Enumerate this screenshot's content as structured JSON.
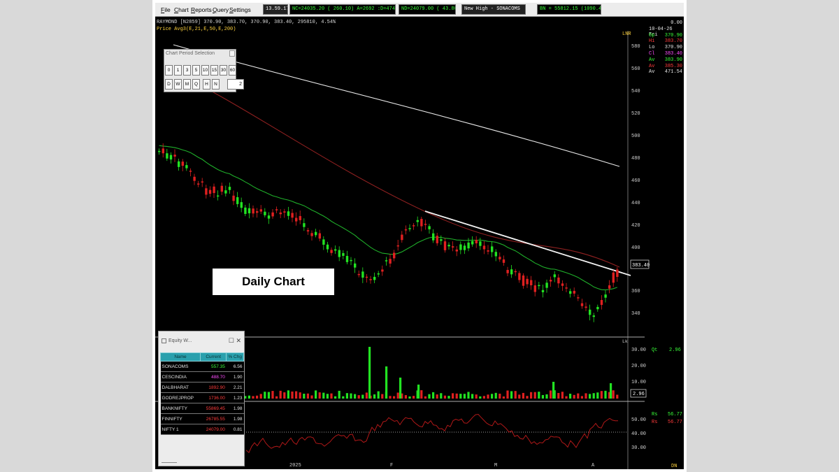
{
  "menu": {
    "items": [
      "File",
      "Chart",
      "Reports",
      "Query",
      "Settings"
    ]
  },
  "status": {
    "time": "13.59.17",
    "nc": "NC=24035.20 ( 260.10) A=2692 :D=474 :S=80",
    "nd": "ND=24079.00 ( 43.80)",
    "new_high": "New High - SONACOMS",
    "bn": "BN = 55812.15 (1090.45)"
  },
  "chart": {
    "symbol_line": "RAYMOND [N2859] 370.90, 383.70, 370.90, 383.40, 295810, 4.54%",
    "price_line": "Price Avg3(E,21,E,50,E,200)",
    "axis_unit": "LNR",
    "price_ticks": [
      "580",
      "560",
      "540",
      "520",
      "500",
      "480",
      "460",
      "440",
      "420",
      "400",
      "360",
      "340"
    ],
    "current_price_tag": "383.40",
    "month_labels": [
      "2025",
      "F",
      "M",
      "A"
    ],
    "volume_unit": "Lk",
    "volume_ticks": [
      "30.00",
      "20.00",
      "10.00"
    ],
    "volume_tag": "2.96",
    "volume_info": {
      "label": "Qt",
      "value": "2.96"
    },
    "rsi_ticks": [
      "50.00",
      "40.00",
      "30.00"
    ],
    "rsi_info": [
      {
        "label": "Rs",
        "value": "56.77",
        "color": "#39ff39"
      },
      {
        "label": "Rs",
        "value": "56.77",
        "color": "#ff3b3b"
      }
    ],
    "rsi_corner": "DN",
    "ohlc": [
      {
        "label": "",
        "value": "0.00",
        "color": "#e6e6e6"
      },
      {
        "label": "10-04-26 Fri",
        "value": "",
        "color": "#e6e6e6"
      },
      {
        "label": "Op",
        "value": "370.90",
        "color": "#39ff39"
      },
      {
        "label": "Hi",
        "value": "383.70",
        "color": "#ff3b3b"
      },
      {
        "label": "Lo",
        "value": "370.90",
        "color": "#e6e6e6"
      },
      {
        "label": "Cl",
        "value": "383.40",
        "color": "#ff4dff"
      },
      {
        "label": "Av",
        "value": "383.90",
        "color": "#39ff39"
      },
      {
        "label": "Av",
        "value": "385.30",
        "color": "#ff3b3b"
      },
      {
        "label": "Av",
        "value": "471.54",
        "color": "#e6e6e6"
      }
    ],
    "colors": {
      "up": "#22e322",
      "down": "#e02020",
      "ema21": "#1fae2a",
      "ema50": "#8e2020",
      "ema200": "#e8e8e8",
      "trendline": "#f2f2f2"
    }
  },
  "period_dialog": {
    "title": "Chart Period Selection",
    "row1": [
      "0",
      "1",
      "3",
      "5",
      "10",
      "15",
      "30",
      "60"
    ],
    "row2": [
      "D",
      "W",
      "M",
      "Q",
      "H",
      "N"
    ],
    "input_value": "2"
  },
  "daily_label": "Daily Chart",
  "watch": {
    "title": "Equity W...",
    "controls": "☐  ✕",
    "headers": [
      "Name",
      "Current",
      "% Chg"
    ],
    "rows": [
      {
        "name": "SONACOMS",
        "current": "557.35",
        "chg": "6.56",
        "color": "#39ff39"
      },
      {
        "name": "CESCINDIA",
        "current": "488.70",
        "chg": "1.90",
        "color": "#ff4dff"
      },
      {
        "name": "DALBHARAT",
        "current": "1892.90",
        "chg": "2.21",
        "color": "#ff3b3b"
      },
      {
        "name": "GODREJPROP",
        "current": "1736.00",
        "chg": "1.23",
        "color": "#ff3b3b"
      },
      {
        "name": "BANKNIFTY",
        "current": "55869.45",
        "chg": "1.98",
        "color": "#ff3b3b"
      },
      {
        "name": "FINNIFTY",
        "current": "26785.55",
        "chg": "1.98",
        "color": "#ff3b3b"
      },
      {
        "name": "NIFTY 1",
        "current": "24079.00",
        "chg": "0.81",
        "color": "#ff3b3b"
      }
    ]
  }
}
